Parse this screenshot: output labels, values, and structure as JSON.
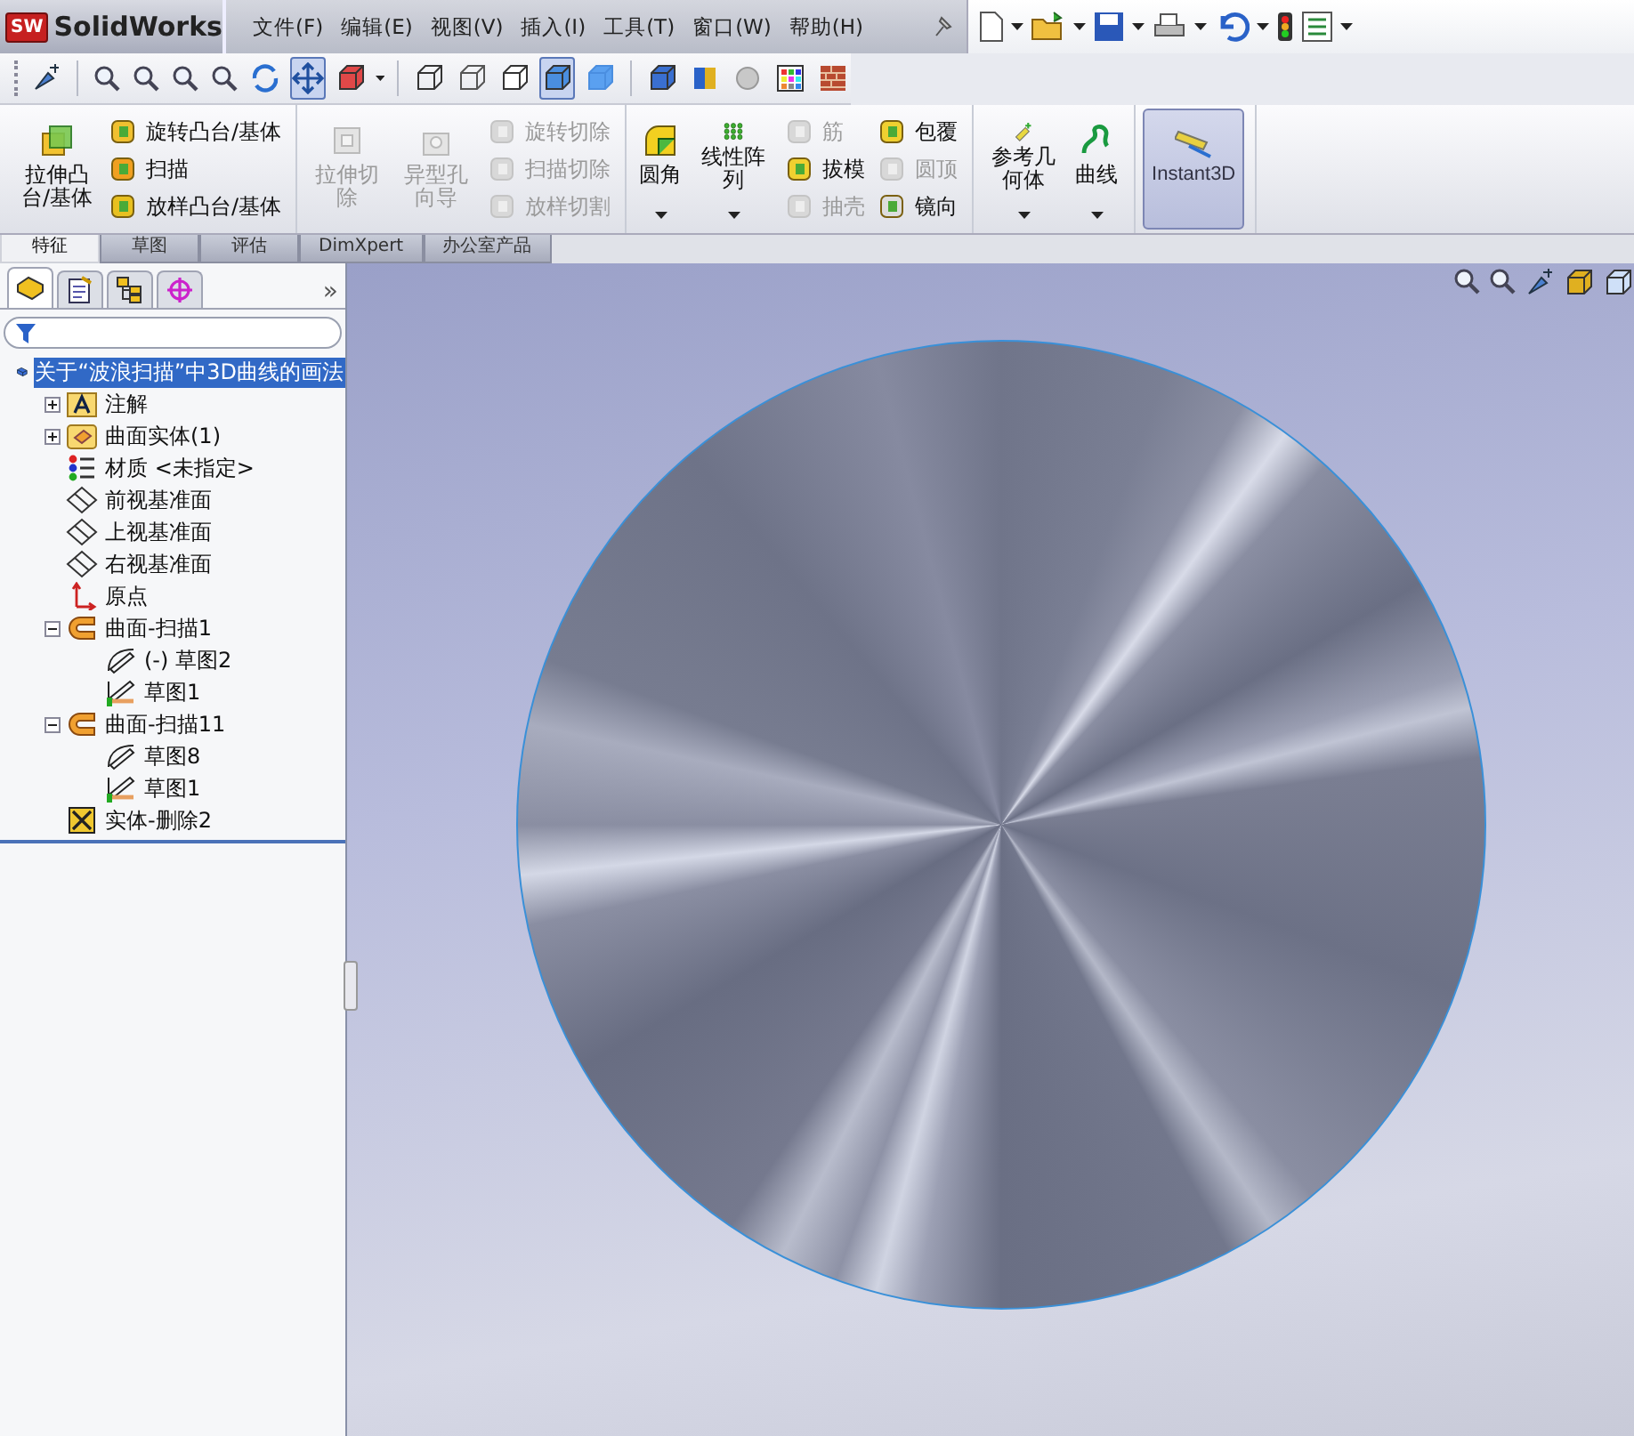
{
  "logo": {
    "badge": "SW",
    "name": "SolidWorks"
  },
  "menus": [
    "文件(F)",
    "编辑(E)",
    "视图(V)",
    "插入(I)",
    "工具(T)",
    "窗口(W)",
    "帮助(H)"
  ],
  "view_tools": [
    {
      "selected": false
    },
    {
      "selected": false
    },
    {
      "selected": false
    },
    {
      "selected": false
    },
    {
      "selected": false
    },
    {
      "selected": false
    },
    {
      "selected": true
    },
    {
      "selected": false
    },
    {
      "selected": false
    },
    {
      "selected": false
    },
    {
      "selected": false
    },
    {
      "selected": true
    },
    {
      "selected": false
    },
    {
      "selected": false
    },
    {
      "selected": false
    },
    {
      "selected": false
    },
    {
      "selected": false
    },
    {
      "selected": false
    }
  ],
  "command_groups": [
    {
      "items": [
        {
          "kind": "large",
          "label": "拉伸凸台/基体",
          "disabled": false
        },
        {
          "kind": "stack",
          "items": [
            {
              "label": "旋转凸台/基体",
              "disabled": false
            },
            {
              "label": "扫描",
              "disabled": false
            },
            {
              "label": "放样凸台/基体",
              "disabled": false
            }
          ]
        }
      ]
    },
    {
      "items": [
        {
          "kind": "large",
          "label": "拉伸切除",
          "disabled": true
        },
        {
          "kind": "large",
          "label": "异型孔向导",
          "disabled": true
        },
        {
          "kind": "stack",
          "items": [
            {
              "label": "旋转切除",
              "disabled": true
            },
            {
              "label": "扫描切除",
              "disabled": true
            },
            {
              "label": "放样切割",
              "disabled": true
            }
          ]
        }
      ]
    },
    {
      "items": [
        {
          "kind": "large",
          "label": "圆角",
          "disabled": false,
          "dropdown": true
        },
        {
          "kind": "large",
          "label": "线性阵列",
          "disabled": false,
          "dropdown": true
        },
        {
          "kind": "stack",
          "items": [
            {
              "label": "筋",
              "disabled": true
            },
            {
              "label": "拔模",
              "disabled": false
            },
            {
              "label": "抽壳",
              "disabled": true
            }
          ]
        },
        {
          "kind": "stack",
          "items": [
            {
              "label": "包覆",
              "disabled": false
            },
            {
              "label": "圆顶",
              "disabled": true
            },
            {
              "label": "镜向",
              "disabled": false
            }
          ]
        }
      ]
    },
    {
      "items": [
        {
          "kind": "large",
          "label": "参考几何体",
          "disabled": false,
          "dropdown": true
        },
        {
          "kind": "large",
          "label": "曲线",
          "disabled": false,
          "dropdown": true
        }
      ]
    },
    {
      "items": [
        {
          "kind": "toggle",
          "label": "Instant3D",
          "selected": true
        }
      ]
    }
  ],
  "tabs": [
    {
      "label": "特征",
      "selected": true
    },
    {
      "label": "草图",
      "selected": false
    },
    {
      "label": "评估",
      "selected": false
    },
    {
      "label": "DimXpert",
      "selected": false
    },
    {
      "label": "办公室产品",
      "selected": false
    }
  ],
  "panel_tabs": [
    {
      "selected": true
    },
    {
      "selected": false
    },
    {
      "selected": false
    },
    {
      "selected": false
    }
  ],
  "panel_more": "»",
  "tree": {
    "label": "关于“波浪扫描”中3D曲线的画法",
    "selected": true,
    "children": [
      {
        "kind": "annotations",
        "label": "注解",
        "expanded": false,
        "selected": false
      },
      {
        "kind": "surface-bodies",
        "label": "曲面实体(1)",
        "expanded": false,
        "selected": false
      },
      {
        "kind": "material",
        "label": "材质 <未指定>",
        "selected": false
      },
      {
        "kind": "plane",
        "label": "前视基准面",
        "selected": false
      },
      {
        "kind": "plane",
        "label": "上视基准面",
        "selected": false
      },
      {
        "kind": "plane",
        "label": "右视基准面",
        "selected": false
      },
      {
        "kind": "origin",
        "label": "原点",
        "selected": false
      },
      {
        "kind": "sweep",
        "label": "曲面-扫描1",
        "expanded": true,
        "selected": false,
        "children": [
          {
            "kind": "sketch3d",
            "label": "(-) 草图2",
            "selected": false
          },
          {
            "kind": "sketch",
            "label": "草图1",
            "selected": false
          }
        ]
      },
      {
        "kind": "sweep",
        "label": "曲面-扫描11",
        "expanded": true,
        "selected": false,
        "children": [
          {
            "kind": "sketch3d",
            "label": "草图8",
            "selected": false
          },
          {
            "kind": "sketch",
            "label": "草图1",
            "selected": false
          }
        ]
      },
      {
        "kind": "delete-body",
        "label": "实体-删除2",
        "selected": false
      }
    ]
  }
}
